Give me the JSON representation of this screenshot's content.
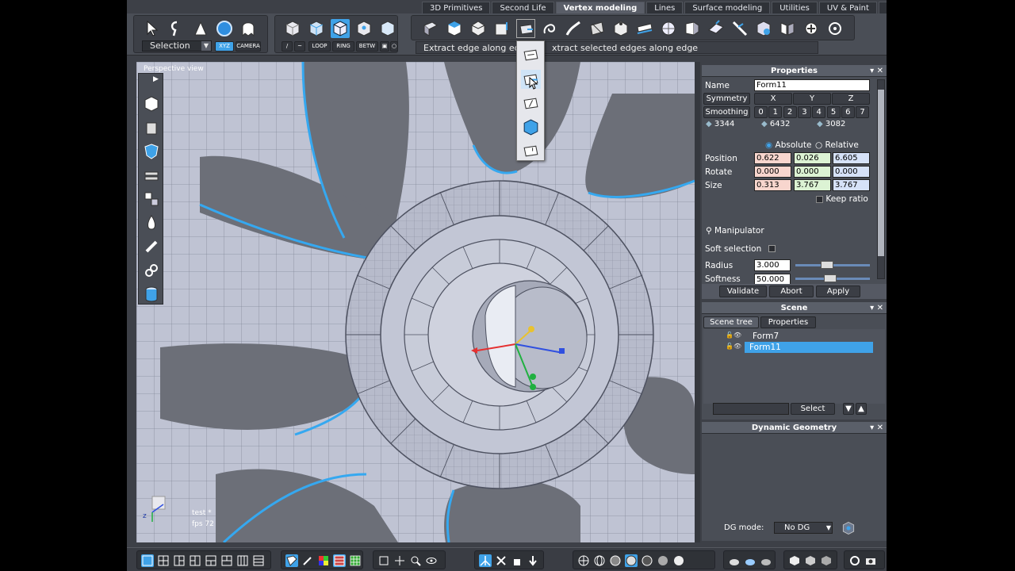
{
  "tabs": [
    {
      "label": "3D Primitives"
    },
    {
      "label": "Second Life"
    },
    {
      "label": "Vertex modeling"
    },
    {
      "label": "Lines"
    },
    {
      "label": "Surface modeling"
    },
    {
      "label": "Utilities"
    },
    {
      "label": "UV & Paint"
    },
    {
      "label": "Custo"
    }
  ],
  "toolbar": {
    "selection_value": "Selection",
    "xyz_label": "XYZ",
    "camera_label": "CAMERA",
    "loop_label": "LOOP",
    "ring_label": "RING",
    "betw_label": "BETW",
    "status_text": "Extract edge along ed",
    "status_text2": "xtract selected edges along edge"
  },
  "viewport": {
    "label": "Perspective view",
    "hud_name": "test *",
    "hud_fps": "fps 72",
    "axis_z": "z"
  },
  "properties": {
    "title": "Properties",
    "name_label": "Name",
    "name_value": "Form11",
    "symmetry_label": "Symmetry",
    "sym_x": "X",
    "sym_y": "Y",
    "sym_z": "Z",
    "smoothing_label": "Smoothing",
    "smoothing_levels": [
      "0",
      "1",
      "2",
      "3",
      "4",
      "5",
      "6",
      "7"
    ],
    "count_vertices": "3344",
    "count_edges": "6432",
    "count_faces": "3082",
    "absolute_label": "Absolute",
    "relative_label": "Relative",
    "position_label": "Position",
    "position": [
      "0.622",
      "0.026",
      "6.605"
    ],
    "rotate_label": "Rotate",
    "rotate": [
      "0.000",
      "0.000",
      "0.000"
    ],
    "size_label": "Size",
    "size": [
      "0.313",
      "3.767",
      "3.767"
    ],
    "keep_ratio_label": "Keep ratio",
    "manipulator_label": "Manipulator",
    "soft_selection_label": "Soft selection",
    "radius_label": "Radius",
    "radius_value": "3.000",
    "softness_label": "Softness",
    "softness_value": "50.000",
    "validate_label": "Validate",
    "abort_label": "Abort",
    "apply_label": "Apply"
  },
  "scene": {
    "title": "Scene",
    "tab_tree": "Scene tree",
    "tab_props": "Properties",
    "items": [
      {
        "label": "Form7"
      },
      {
        "label": "Form11"
      }
    ],
    "select_label": "Select"
  },
  "dynamic": {
    "title": "Dynamic Geometry",
    "dg_mode_label": "DG mode:",
    "dg_mode_value": "No DG"
  },
  "colors": {
    "accent": "#3fa2e8",
    "mesh": "#b8bccb",
    "panel": "#4a4e56"
  }
}
